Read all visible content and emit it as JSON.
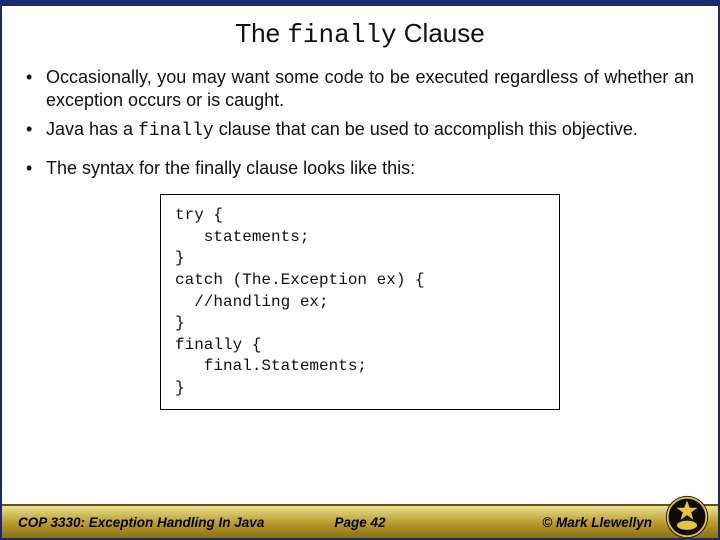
{
  "title": {
    "pre": "The ",
    "code": "finally",
    "post": " Clause"
  },
  "bullets": [
    {
      "text": "Occasionally, you may want some code to be executed regardless of whether an exception occurs or is caught.",
      "code": ""
    },
    {
      "text_pre": "Java has a ",
      "code": "finally",
      "text_post": " clause that can be used to accomplish this objective."
    },
    {
      "text": "The syntax for the finally clause looks like this:",
      "code": ""
    }
  ],
  "code": "try {\n   statements;\n}\ncatch (The.Exception ex) {\n  //handling ex;\n}\nfinally {\n   final.Statements;\n}",
  "footer": {
    "course": "COP 3330: Exception Handling In Java",
    "page": "Page 42",
    "author": "© Mark Llewellyn"
  }
}
